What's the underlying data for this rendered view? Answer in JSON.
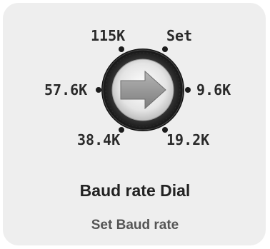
{
  "widget": {
    "title": "Baud rate Dial",
    "subtitle": "Set Baud rate",
    "center_icon": "arrow-right-icon"
  },
  "dial": {
    "options": [
      {
        "key": "115k",
        "label": "115K"
      },
      {
        "key": "set",
        "label": "Set"
      },
      {
        "key": "57_6k",
        "label": "57.6K"
      },
      {
        "key": "9_6k",
        "label": "9.6K"
      },
      {
        "key": "38_4k",
        "label": "38.4K"
      },
      {
        "key": "19_2k",
        "label": "19.2K"
      }
    ],
    "pointer_direction": "right"
  },
  "colors": {
    "card_background": "#eeeeee",
    "dial_ring": "#1f1f1f",
    "dial_face": "#e6e6e6",
    "arrow_fill": "#9a9a9a",
    "label_text": "#2a2a2a",
    "subtitle_text": "#555555"
  }
}
